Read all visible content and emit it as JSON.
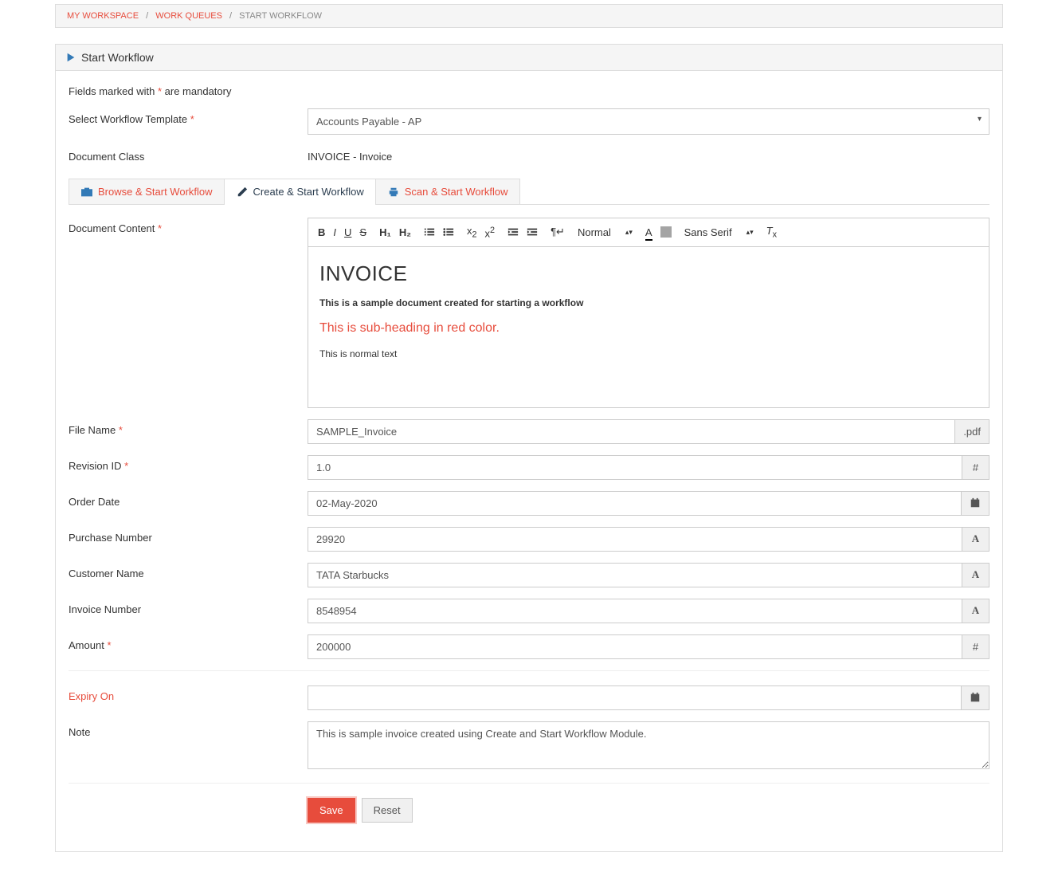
{
  "breadcrumb": {
    "home": "MY WORKSPACE",
    "parent": "WORK QUEUES",
    "current": "START WORKFLOW"
  },
  "panel": {
    "title": "Start Workflow"
  },
  "notes": {
    "mandatory_pre": "Fields marked with ",
    "mandatory_post": " are mandatory"
  },
  "labels": {
    "select_template": "Select Workflow Template",
    "document_class": "Document Class",
    "document_content": "Document Content",
    "file_name": "File Name",
    "revision_id": "Revision ID",
    "order_date": "Order Date",
    "purchase_number": "Purchase Number",
    "customer_name": "Customer Name",
    "invoice_number": "Invoice Number",
    "amount": "Amount",
    "expiry_on": "Expiry On",
    "note": "Note"
  },
  "values": {
    "template": "Accounts Payable - AP",
    "document_class": "INVOICE - Invoice",
    "file_name": "SAMPLE_Invoice",
    "file_ext": ".pdf",
    "revision_id": "1.0",
    "order_date": "02-May-2020",
    "purchase_number": "29920",
    "customer_name": "TATA Starbucks",
    "invoice_number": "8548954",
    "amount": "200000",
    "expiry_on": "",
    "note": "This is sample invoice created using Create and Start Workflow Module."
  },
  "tabs": {
    "browse": "Browse & Start Workflow",
    "create": "Create & Start Workflow",
    "scan": "Scan & Start Workflow"
  },
  "toolbar": {
    "format": "Normal",
    "font": "Sans Serif"
  },
  "editor": {
    "h1": "INVOICE",
    "p1": "This is a sample document created for starting a workflow",
    "sub": "This is sub-heading in red color.",
    "p2": "This is normal text"
  },
  "buttons": {
    "save": "Save",
    "reset": "Reset"
  },
  "icons": {
    "hash": "#",
    "font": "A"
  }
}
